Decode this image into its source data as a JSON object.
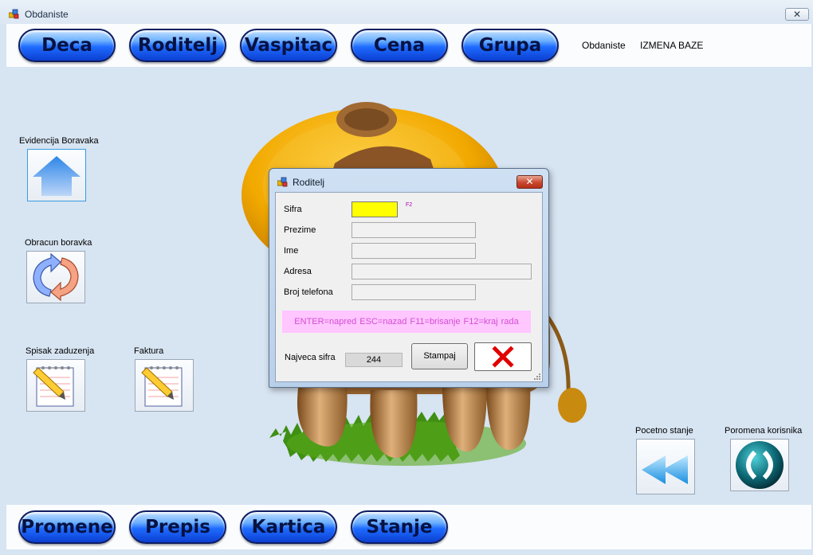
{
  "window": {
    "title": "Obdaniste",
    "close_label": "✕"
  },
  "top_nav": [
    {
      "label": "Deca"
    },
    {
      "label": "Roditelj"
    },
    {
      "label": "Vaspitac"
    },
    {
      "label": "Cena"
    },
    {
      "label": "Grupa"
    }
  ],
  "top_labels": {
    "app": "Obdaniste",
    "mode": "IZMENA BAZE"
  },
  "side": {
    "evidencija": "Evidencija Boravaka",
    "obracun": "Obracun boravka",
    "spisak": "Spisak zaduzenja",
    "faktura": "Faktura",
    "pocetno": "Pocetno stanje",
    "poromena": "Poromena korisnika"
  },
  "bottom_nav": [
    {
      "label": "Promene"
    },
    {
      "label": "Prepis"
    },
    {
      "label": "Kartica"
    },
    {
      "label": "Stanje"
    }
  ],
  "dialog": {
    "title": "Roditelj",
    "close_label": "✕",
    "fields": {
      "sifra": {
        "label": "Sifra",
        "value": ""
      },
      "prezime": {
        "label": "Prezime",
        "value": ""
      },
      "ime": {
        "label": "Ime",
        "value": ""
      },
      "adresa": {
        "label": "Adresa",
        "value": ""
      },
      "telefon": {
        "label": "Broj telefona",
        "value": ""
      }
    },
    "f2_hint": "F2",
    "hotkeys": "ENTER=napred   ESC=nazad   F11=brisanje   F12=kraj rada",
    "max_label": "Najveca sifra",
    "max_value": "244",
    "print_label": "Stampaj"
  },
  "icons": {
    "app": "window-app-icon",
    "evidencija": "home-arrow-icon",
    "obracun": "refresh-arrows-icon",
    "spisak": "notepad-pencil-icon",
    "faktura": "notepad-pencil-icon",
    "pocetno": "rewind-icon",
    "poromena": "user-switch-icon",
    "close_x": "red-x-icon"
  },
  "colors": {
    "pill_blue": "#1f6bff",
    "sifra_highlight": "#ffff00",
    "hotkey_bg": "#ffc6ff",
    "hotkey_text": "#d44cd4",
    "close_red": "#e00000"
  }
}
